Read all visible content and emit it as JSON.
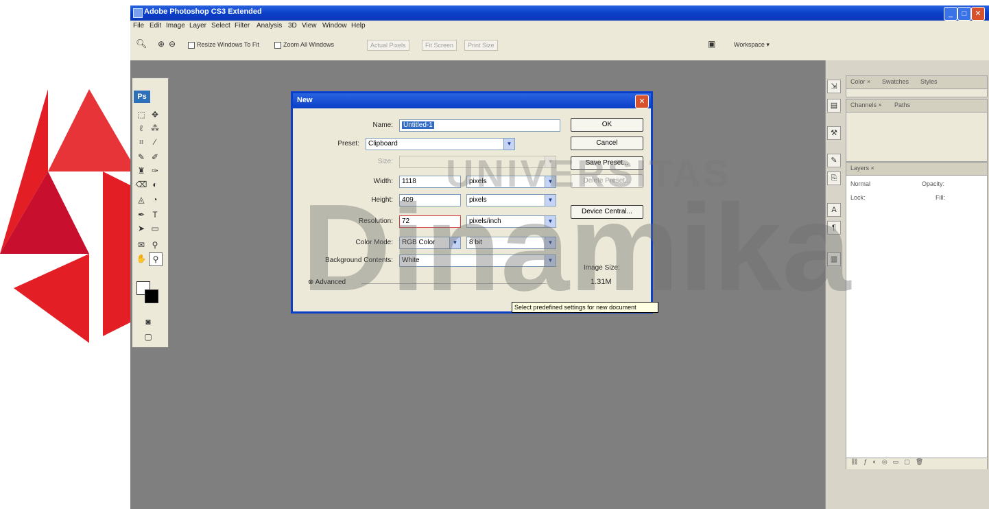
{
  "window": {
    "title": "Adobe Photoshop CS3 Extended"
  },
  "menu": {
    "items": [
      "File",
      "Edit",
      "Image",
      "Layer",
      "Select",
      "Filter",
      "Analysis",
      "3D",
      "View",
      "Window",
      "Help"
    ]
  },
  "options_bar": {
    "resize_windows_label": "Resize Windows To Fit",
    "zoom_all_windows_label": "Zoom All Windows",
    "actual_pixels_label": "Actual Pixels",
    "fit_screen_label": "Fit Screen",
    "print_size_label": "Print Size",
    "workspace_label": "Workspace ▾"
  },
  "toolbox": {
    "logo": "Ps"
  },
  "panels": {
    "tabs_top": [
      "Color ×",
      "Swatches",
      "Styles"
    ],
    "tabs_mid": [
      "Channels ×",
      "Paths"
    ],
    "layers_tab": "Layers ×",
    "layers_mode": "Normal",
    "layers_opacity": "Opacity:",
    "layers_lock": "Lock:",
    "layers_fill": "Fill:"
  },
  "dialog": {
    "title": "New",
    "name_label": "Name:",
    "name_value": "Untitled-1",
    "preset_label": "Preset:",
    "preset_value": "Clipboard",
    "size_label": "Size:",
    "width_label": "Width:",
    "width_value": "1118",
    "width_unit": "pixels",
    "height_label": "Height:",
    "height_value": "409",
    "height_unit": "pixels",
    "resolution_label": "Resolution:",
    "resolution_value": "72",
    "resolution_unit": "pixels/inch",
    "color_mode_label": "Color Mode:",
    "color_mode_value": "RGB Color",
    "bit_depth_value": "8 bit",
    "background_label": "Background Contents:",
    "background_value": "White",
    "advanced_label": "Advanced",
    "image_size_label": "Image Size:",
    "image_size_value": "1.31M",
    "ok_label": "OK",
    "cancel_label": "Cancel",
    "save_preset_label": "Save Preset...",
    "delete_preset_label": "Delete Preset...",
    "device_central_label": "Device Central..."
  },
  "tooltip": "Select predefined settings for new document",
  "watermark": {
    "word1": "UNIVERSITAS",
    "word2": "Dinamika"
  },
  "colors": {
    "workspace": "#7f7f7f",
    "titlebar": "#0a3fc8",
    "dialog_bg": "#ece9d8",
    "selection": "#316ac5"
  }
}
